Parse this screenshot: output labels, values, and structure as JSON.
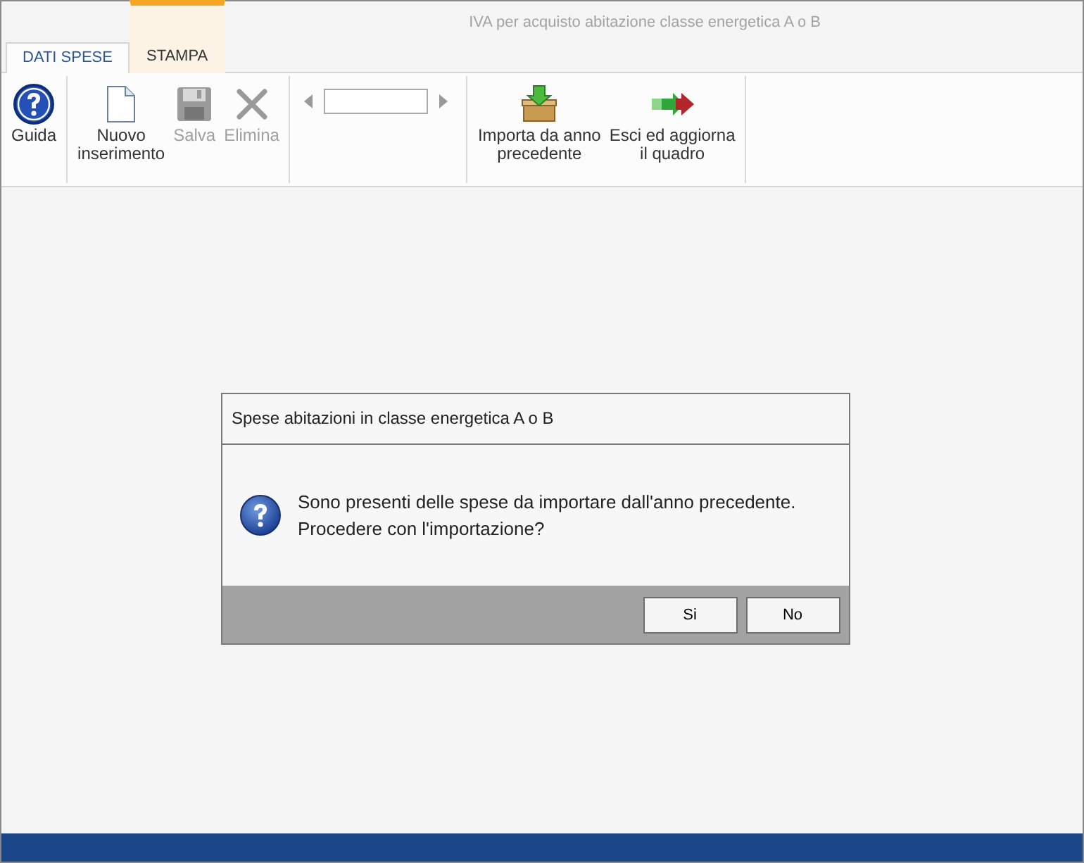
{
  "window": {
    "title": "IVA per acquisto abitazione classe energetica A o B"
  },
  "tabs": [
    {
      "label": "DATI SPESE",
      "selected": true,
      "highlighted": false
    },
    {
      "label": "STAMPA",
      "selected": false,
      "highlighted": true
    }
  ],
  "ribbon": {
    "groups": [
      {
        "kind": "buttons",
        "items": [
          {
            "label": "Guida",
            "kind": "help",
            "disabled": false
          }
        ]
      },
      {
        "kind": "buttons",
        "items": [
          {
            "label": "Nuovo\ninserimento",
            "kind": "page",
            "disabled": false
          },
          {
            "label": "Salva",
            "kind": "disk",
            "disabled": true
          },
          {
            "label": "Elimina",
            "kind": "cross",
            "disabled": true
          }
        ]
      },
      {
        "kind": "navigator"
      },
      {
        "kind": "buttons",
        "items": [
          {
            "label": "Importa da anno\nprecedente",
            "kind": "import",
            "disabled": false
          },
          {
            "label": "Esci ed aggiorna\nil quadro",
            "kind": "exit",
            "disabled": false
          }
        ]
      }
    ]
  },
  "dialog": {
    "title": "Spese abitazioni in classe energetica A o B",
    "message": "Sono presenti delle spese da importare dall'anno precedente.\nProcedere con l'importazione?",
    "buttons": [
      "Si",
      "No"
    ]
  }
}
